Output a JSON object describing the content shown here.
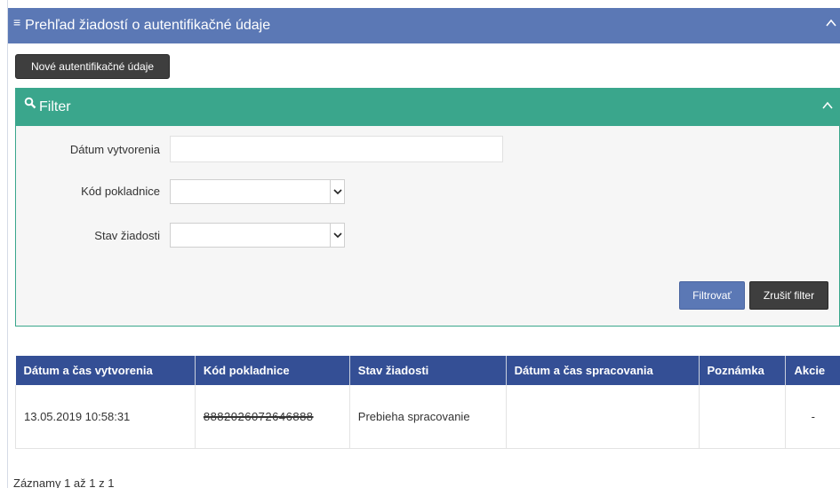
{
  "header": {
    "title": "Prehľad žiadostí o autentifikačné údaje",
    "menu_icon": "hamburger-icon",
    "collapse_icon": "chevron-up-icon"
  },
  "toolbar": {
    "new_button": "Nové autentifikačné údaje"
  },
  "filter": {
    "title": "Filter",
    "fields": {
      "created_label": "Dátum vytvorenia",
      "created_value": "",
      "cash_register_label": "Kód pokladnice",
      "cash_register_value": "",
      "status_label": "Stav žiadosti",
      "status_value": ""
    },
    "apply_button": "Filtrovať",
    "reset_button": "Zrušiť filter"
  },
  "table": {
    "columns": [
      "Dátum a čas vytvorenia",
      "Kód pokladnice",
      "Stav žiadosti",
      "Dátum a čas spracovania",
      "Poznámka",
      "Akcie"
    ],
    "rows": [
      {
        "created": "13.05.2019 10:58:31",
        "cash_register": "8882026072646888",
        "status": "Prebieha spracovanie",
        "processed": "",
        "note": "",
        "actions": "-"
      }
    ]
  },
  "footer": {
    "records": "Záznamy 1 až 1 z 1"
  },
  "colors": {
    "header": "#5b78b5",
    "filter": "#3aa68c",
    "table_header": "#344f95",
    "dark_button": "#3e3e3e"
  }
}
